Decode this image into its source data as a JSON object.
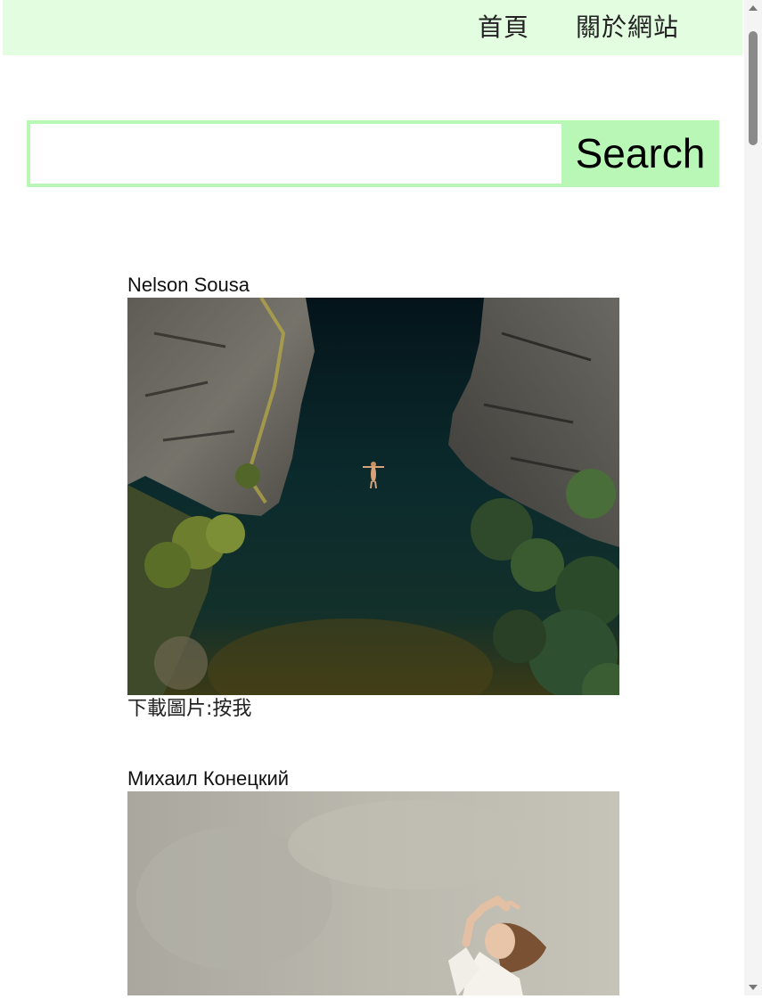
{
  "nav": {
    "home_label": "首頁",
    "about_label": "關於網站"
  },
  "search": {
    "value": "",
    "button_label": "Search"
  },
  "cards": [
    {
      "author": "Nelson Sousa",
      "download_label": "下載圖片:按我"
    },
    {
      "author": "Михаил Конецкий"
    }
  ],
  "colors": {
    "nav_bg": "#e3fde0",
    "search_accent": "#b8f7b6"
  }
}
